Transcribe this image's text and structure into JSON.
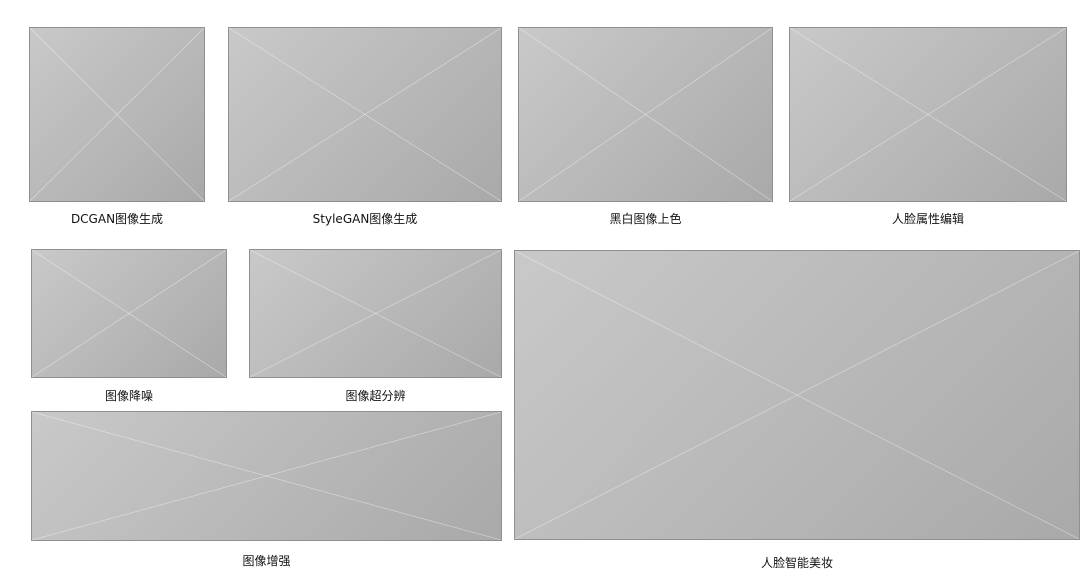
{
  "captions": {
    "dcgan": "DCGAN图像生成",
    "stylegan": "StyleGAN图像生成",
    "colorize": "黑白图像上色",
    "face_edit": "人脸属性编辑",
    "denoise": "图像降噪",
    "super_res": "图像超分辨",
    "enhance": "图像增强",
    "makeup": "人脸智能美妆"
  }
}
